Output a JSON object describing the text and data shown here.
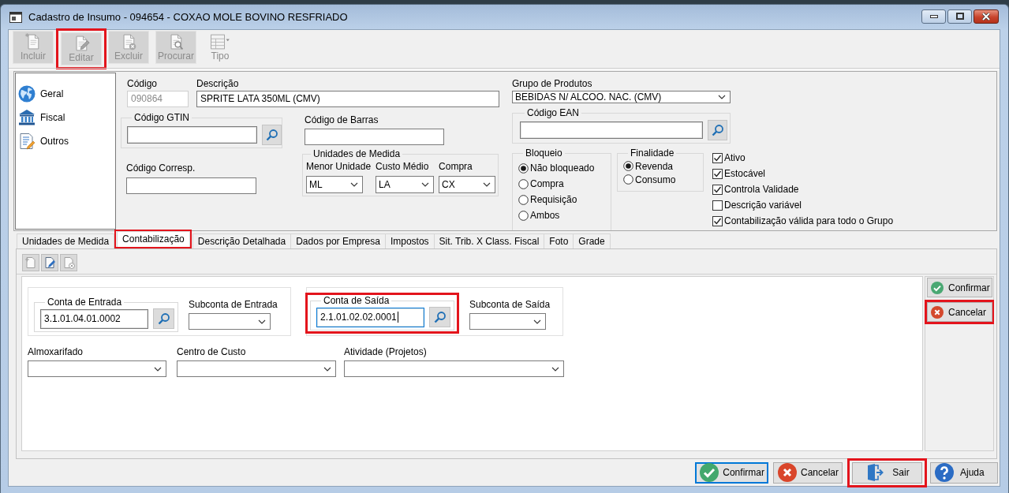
{
  "window": {
    "title": "Cadastro de Insumo - 094654 - COXAO MOLE BOVINO RESFRIADO"
  },
  "toolbar": [
    {
      "kind": "add",
      "label": "Incluir",
      "disabled": true,
      "highlighted": false
    },
    {
      "kind": "edit",
      "label": "Editar",
      "disabled": true,
      "highlighted": true
    },
    {
      "kind": "delete",
      "label": "Excluir",
      "disabled": true,
      "highlighted": false
    },
    {
      "kind": "find",
      "label": "Procurar",
      "disabled": true,
      "highlighted": false
    },
    {
      "kind": "view",
      "label": "Tipo",
      "disabled": true,
      "highlighted": false
    }
  ],
  "sidebar": {
    "items": [
      {
        "kind": "globe",
        "label": "Geral"
      },
      {
        "kind": "bank",
        "label": "Fiscal"
      },
      {
        "kind": "notes",
        "label": "Outros"
      }
    ]
  },
  "form": {
    "codigo": {
      "label": "Código",
      "value": "090864",
      "disabled": true
    },
    "descricao": {
      "label": "Descrição",
      "value": "SPRITE LATA 350ML (CMV)"
    },
    "grupo": {
      "label": "Grupo de Produtos",
      "value": "BEBIDAS N/ ALCOO. NAC. (CMV)"
    },
    "gtin": {
      "label": "Código GTIN"
    },
    "barras": {
      "label": "Código de Barras"
    },
    "ean": {
      "label": "Código EAN"
    },
    "corresp": {
      "label": "Código Corresp."
    },
    "unidades": {
      "title": "Unidades de Medida",
      "fields": [
        {
          "label": "Menor Unidade",
          "value": "ML"
        },
        {
          "label": "Custo Médio",
          "value": "LA"
        },
        {
          "label": "Compra",
          "value": "CX"
        }
      ]
    },
    "bloqueio": {
      "title": "Bloqueio",
      "options": [
        {
          "label": "Não bloqueado",
          "selected": true
        },
        {
          "label": "Compra",
          "selected": false
        },
        {
          "label": "Requisição",
          "selected": false
        },
        {
          "label": "Ambos",
          "selected": false
        }
      ]
    },
    "finalidade": {
      "title": "Finalidade",
      "options": [
        {
          "label": "Revenda",
          "selected": true
        },
        {
          "label": "Consumo",
          "selected": false
        }
      ]
    },
    "flags": [
      {
        "label": "Ativo",
        "checked": true
      },
      {
        "label": "Estocável",
        "checked": true
      },
      {
        "label": "Controla Validade",
        "checked": true
      },
      {
        "label": "Descrição variável",
        "checked": false
      },
      {
        "label": "Contabilização válida para todo o Grupo",
        "checked": true
      }
    ]
  },
  "tabs": [
    {
      "label": "Unidades de Medida",
      "selected": false,
      "highlighted": false
    },
    {
      "label": "Contabilização",
      "selected": true,
      "highlighted": true
    },
    {
      "label": "Descrição Detalhada",
      "selected": false,
      "highlighted": false
    },
    {
      "label": "Dados por Empresa",
      "selected": false,
      "highlighted": false
    },
    {
      "label": "Impostos",
      "selected": false,
      "highlighted": false
    },
    {
      "label": "Sit. Trib. X Class. Fiscal",
      "selected": false,
      "highlighted": false
    },
    {
      "label": "Foto",
      "selected": false,
      "highlighted": false
    },
    {
      "label": "Grade",
      "selected": false,
      "highlighted": false
    }
  ],
  "tab_toolbar": [
    {
      "kind": "add",
      "disabled": true
    },
    {
      "kind": "edit",
      "disabled": false
    },
    {
      "kind": "delete",
      "disabled": true
    }
  ],
  "accounts": [
    {
      "title": "Conta de Entrada",
      "value": "3.1.01.04.01.0002",
      "sub_label": "Subconta de Entrada",
      "focused": false,
      "highlighted": false
    },
    {
      "title": "Conta de Saída",
      "value": "2.1.01.02.02.0001",
      "sub_label": "Subconta de Saída",
      "focused": true,
      "highlighted": true
    }
  ],
  "selects": [
    {
      "label": "Almoxarifado"
    },
    {
      "label": "Centro de Custo"
    },
    {
      "label": "Atividade (Projetos)"
    }
  ],
  "side_buttons": [
    {
      "kind": "confirm",
      "label": "Confirmar",
      "highlighted": false
    },
    {
      "kind": "cancel",
      "label": "Cancelar",
      "highlighted": true
    }
  ],
  "footer_buttons": [
    {
      "kind": "confirm",
      "label": "Confirmar",
      "focused": true,
      "highlighted": false
    },
    {
      "kind": "cancel",
      "label": "Cancelar",
      "focused": false,
      "highlighted": false
    },
    {
      "kind": "exit",
      "label": "Sair",
      "focused": false,
      "highlighted": true
    },
    {
      "kind": "help",
      "label": "Ajuda",
      "focused": false,
      "highlighted": false
    }
  ]
}
